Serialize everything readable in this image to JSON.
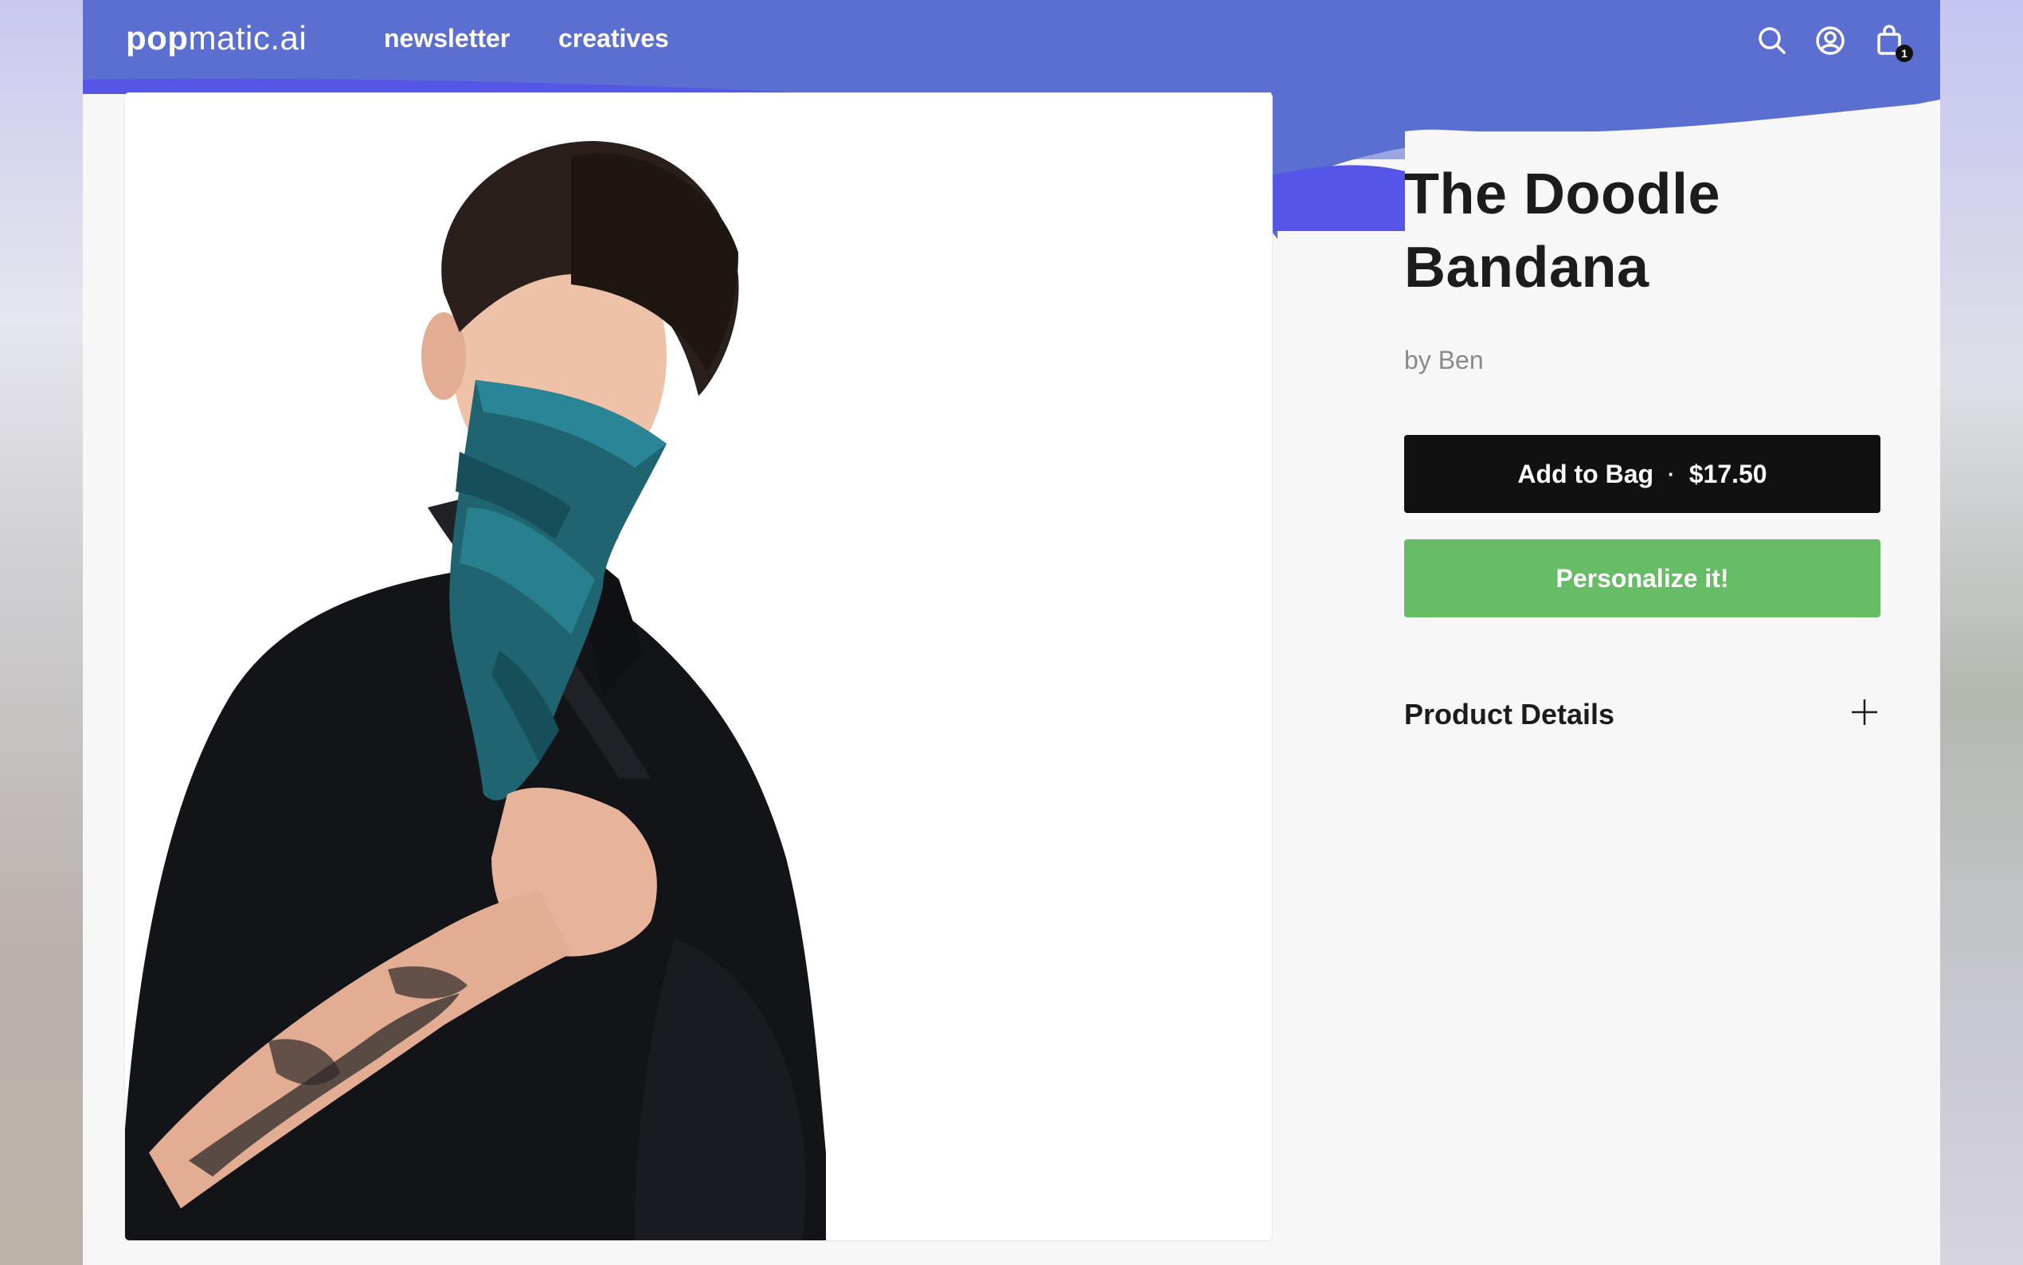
{
  "brand": {
    "logo_bold": "pop",
    "logo_rest": "matic.ai"
  },
  "nav": {
    "links": [
      "newsletter",
      "creatives"
    ],
    "icons": [
      "search-icon",
      "account-icon",
      "shopping-bag-icon"
    ],
    "cart_count": "1"
  },
  "product": {
    "title": "The Doodle Bandana",
    "byline": "by Ben",
    "add_to_bag_label": "Add to Bag",
    "separator": "·",
    "price": "$17.50",
    "personalize_label": "Personalize it!",
    "details_label": "Product Details",
    "image_alt": "Model wearing a teal doodle bandana over face"
  },
  "colors": {
    "header_blue": "#5b6fd0",
    "wave_blue": "#5555e8",
    "add_button": "#111111",
    "personalize_button": "#67bd66"
  }
}
